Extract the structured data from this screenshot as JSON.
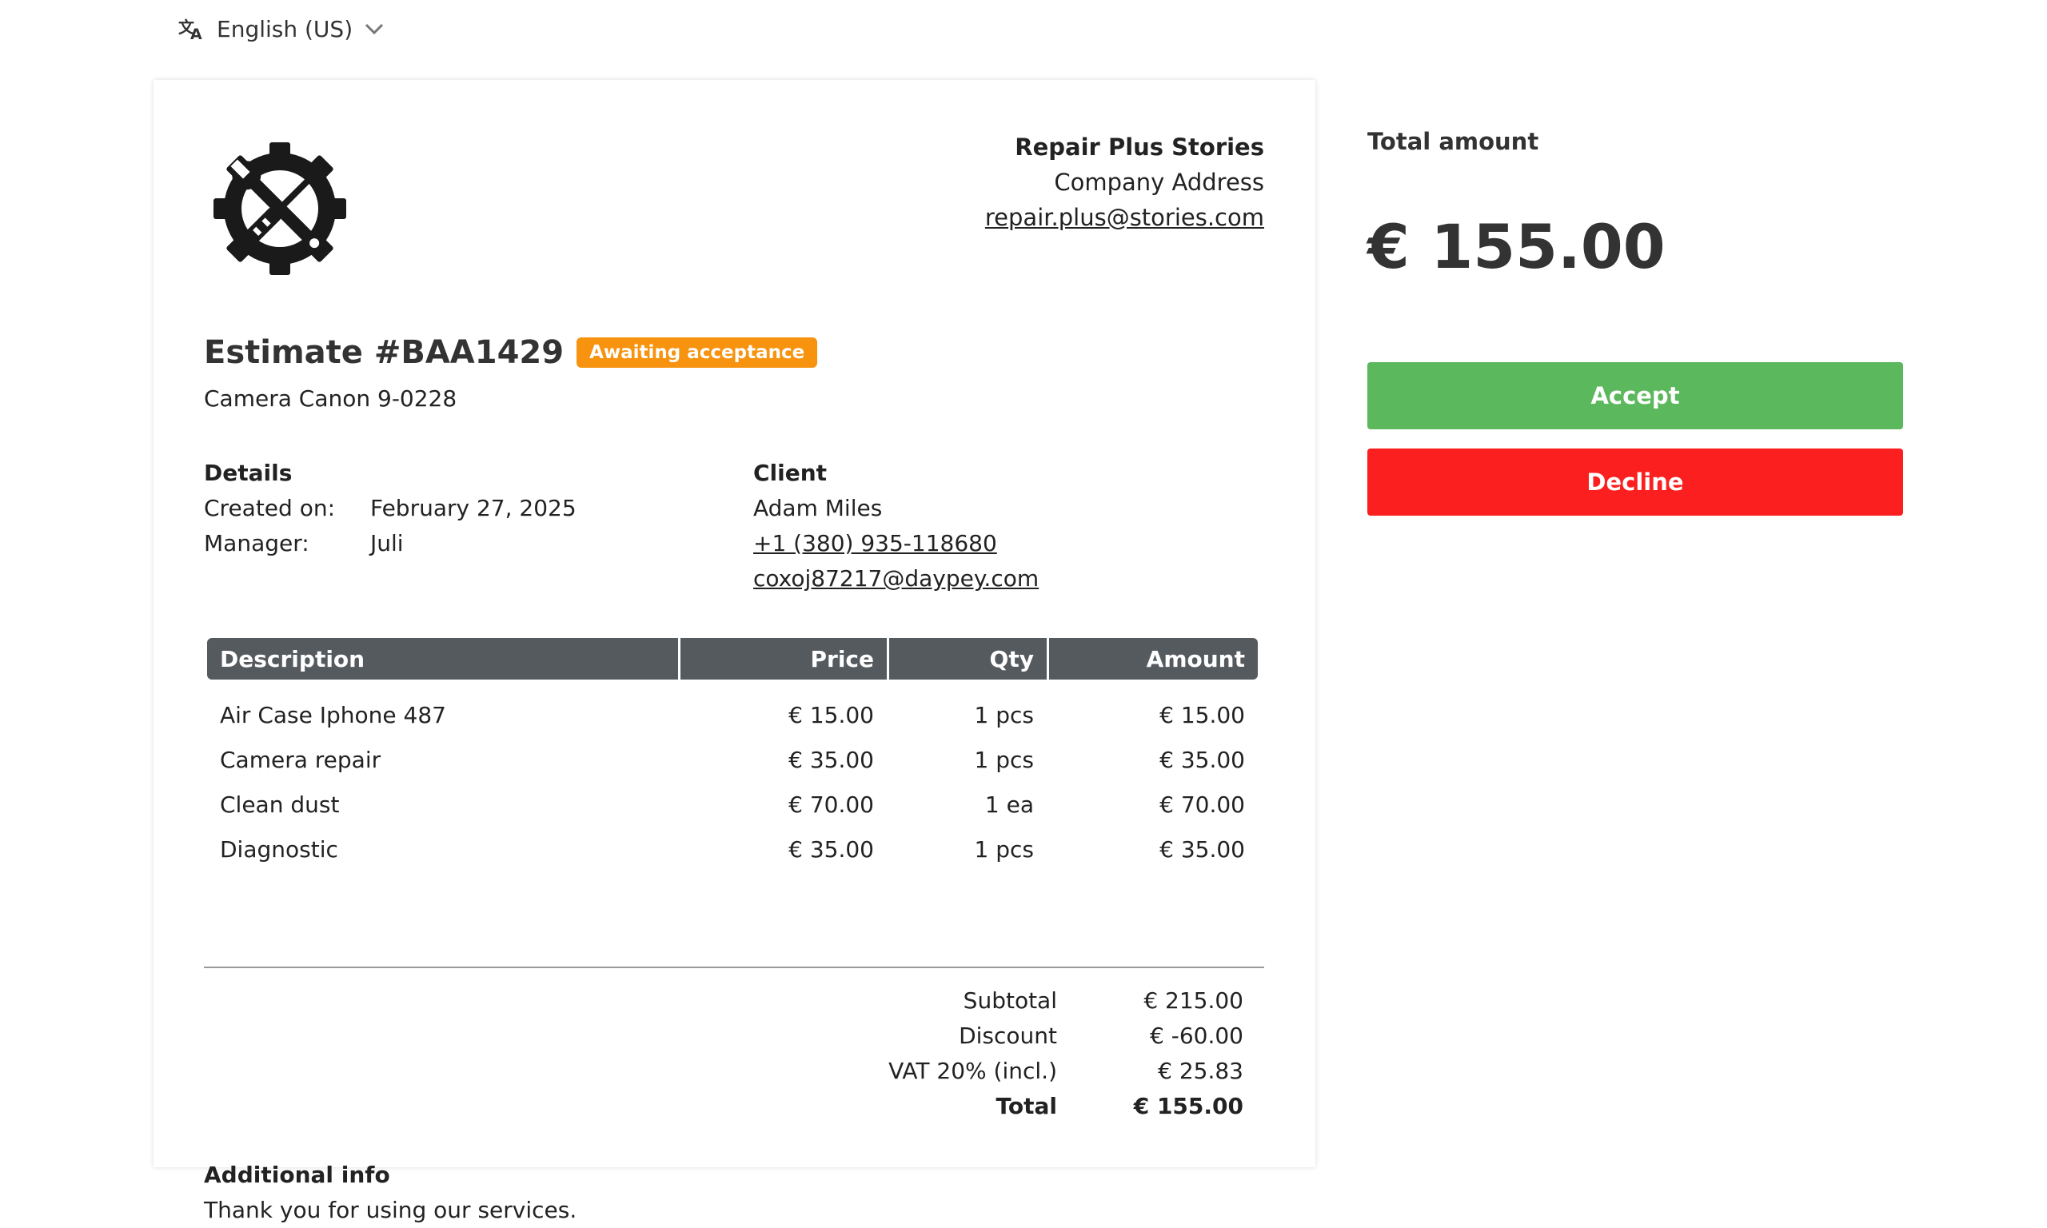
{
  "language": {
    "label": "English (US)",
    "icon": "translate-icon",
    "chevron_icon": "chevron-down-icon"
  },
  "company": {
    "name": "Repair Plus Stories",
    "address": "Company Address",
    "email": "repair.plus@stories.com",
    "logo_icon": "gear-wrench-screwdriver-logo"
  },
  "estimate": {
    "title": "Estimate #BAA1429",
    "status": "Awaiting acceptance",
    "subtitle": "Camera Canon 9-0228"
  },
  "details": {
    "heading": "Details",
    "created_label": "Created on:",
    "created_value": "February 27, 2025",
    "manager_label": "Manager:",
    "manager_value": "Juli"
  },
  "client": {
    "heading": "Client",
    "name": "Adam Miles",
    "phone": "+1 (380) 935-118680",
    "email": "coxoj87217@daypey.com"
  },
  "table": {
    "headers": [
      "Description",
      "Price",
      "Qty",
      "Amount"
    ],
    "rows": [
      [
        "Air Case Iphone 487",
        "€ 15.00",
        "1 pcs",
        "€ 15.00"
      ],
      [
        "Camera repair",
        "€ 35.00",
        "1 pcs",
        "€ 35.00"
      ],
      [
        "Clean dust",
        "€ 70.00",
        "1 ea",
        "€ 70.00"
      ],
      [
        "Diagnostic",
        "€ 35.00",
        "1 pcs",
        "€ 35.00"
      ]
    ]
  },
  "totals": {
    "subtotal_label": "Subtotal",
    "subtotal_value": "€ 215.00",
    "discount_label": "Discount",
    "discount_value": "€ -60.00",
    "vat_label": "VAT 20% (incl.)",
    "vat_value": "€ 25.83",
    "total_label": "Total",
    "total_value": "€ 155.00"
  },
  "additional": {
    "heading": "Additional info",
    "text": "Thank you for using our services."
  },
  "sidebar": {
    "total_label": "Total amount",
    "total_amount": "€ 155.00",
    "accept_label": "Accept",
    "decline_label": "Decline"
  },
  "colors": {
    "badge": "#f7930f",
    "accept": "#5cb85c",
    "decline": "#fb1f1f",
    "table_header": "#555a5f"
  }
}
